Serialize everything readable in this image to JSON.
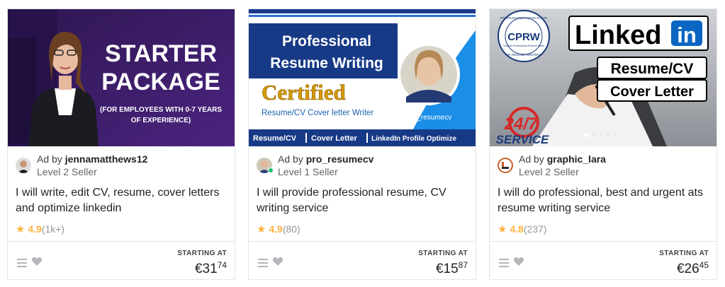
{
  "gigs": [
    {
      "image": {
        "line1": "STARTER",
        "line2": "PACKAGE",
        "sub_line1": "(FOR EMPLOYEES WITH 0-7 YEARS",
        "sub_line2": "OF EXPERIENCE)"
      },
      "ad_by_prefix": "Ad by",
      "seller_name": "jennamatthews12",
      "seller_level": "Level 2 Seller",
      "title": "I will write, edit CV, resume, cover letters and optimize linkedin",
      "rating": "4.9",
      "reviews": "(1k+)",
      "starting_label": "STARTING AT",
      "price_main": "€31",
      "price_cents": "74"
    },
    {
      "image": {
        "line1": "Professional",
        "line2": "Resume Writing",
        "certified": "Certified",
        "sub": "Resume/CV Cover letter Writer",
        "handle": "Pro_resumecv",
        "bar_items": [
          "Resume/CV",
          "Cover Letter",
          "LinkedIn Profile Optimize"
        ]
      },
      "ad_by_prefix": "Ad by",
      "seller_name": "pro_resumecv",
      "seller_level": "Level 1 Seller",
      "title": "I will provide professional resume, CV writing service",
      "rating": "4.9",
      "reviews": "(80)",
      "starting_label": "STARTING AT",
      "price_main": "€15",
      "price_cents": "87"
    },
    {
      "image": {
        "badge": "CPRW",
        "badge_ring_top": "PROFESSIONAL ASSOCIATION",
        "badge_ring_mid": "Certified Professional Resume Writer",
        "badge_ring_bottom": "OF RESUME WRITERS",
        "linked": "Linked",
        "in": "in",
        "line1": "Resume/CV",
        "line2": "Cover Letter",
        "service_num": "24/7",
        "service_word": "SERVICE"
      },
      "ad_by_prefix": "Ad by",
      "seller_name": "graphic_lara",
      "seller_level": "Level 2 Seller",
      "title": "I will do professional, best and urgent ats resume writing service",
      "rating": "4.8",
      "reviews": "(237)",
      "starting_label": "STARTING AT",
      "price_main": "€26",
      "price_cents": "45"
    }
  ],
  "colors": {
    "star": "#ffb33e",
    "purple_bg": "#3a1d63",
    "navy": "#1a3a8a",
    "linkedin_blue": "#0a66c2",
    "service_red": "#d62828"
  },
  "icons": [
    "star-icon",
    "menu-icon",
    "heart-icon"
  ]
}
